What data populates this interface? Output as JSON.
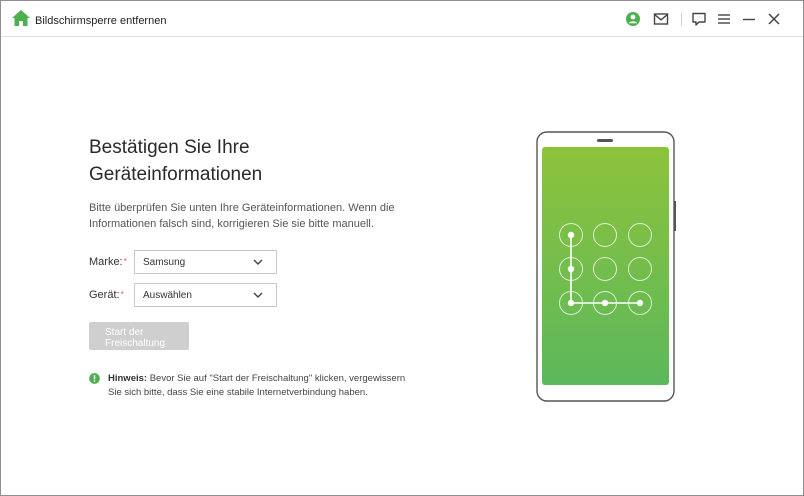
{
  "titlebar": {
    "title": "Bildschirmsperre entfernen",
    "icons": [
      "home-icon",
      "user-icon",
      "mail-icon",
      "feedback-icon",
      "menu-icon",
      "minimize-icon",
      "close-icon"
    ],
    "accent_color": "#4caf50"
  },
  "main": {
    "heading_line1": "Bestätigen Sie Ihre",
    "heading_line2": "Geräteinformationen",
    "description_line1": "Bitte überprüfen Sie unten Ihre Geräteinformationen. Wenn die",
    "description_line2": "Informationen falsch sind, korrigieren Sie sie bitte manuell.",
    "brand_label": "Marke:",
    "brand_value": "Samsung",
    "device_label": "Gerät:",
    "device_value": "Auswählen",
    "required_mark": "*",
    "start_button_line1": "Start der",
    "start_button_line2": "Freischaltung",
    "hint_label": "Hinweis:",
    "hint_text_line1": " Bevor Sie auf \"Start der Freischaltung\" klicken, vergewissern",
    "hint_text_line2": "Sie sich bitte, dass Sie eine stabile Internetverbindung haben."
  },
  "illustration": {
    "type": "phone-pattern-lock",
    "screen_gradient": [
      "#8dc33b",
      "#5cb85c"
    ]
  }
}
